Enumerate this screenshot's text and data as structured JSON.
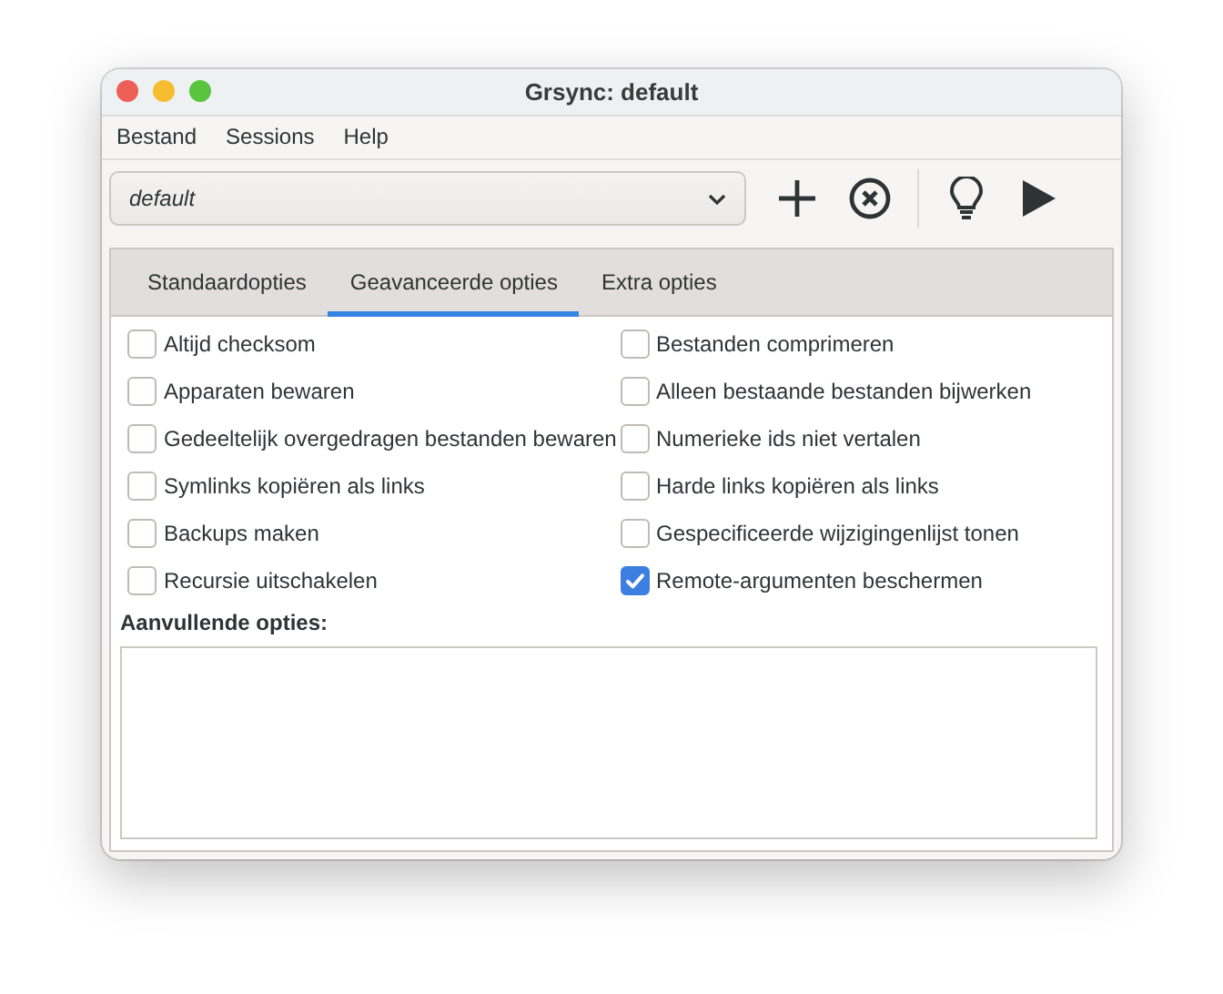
{
  "window": {
    "title": "Grsync: default"
  },
  "menu": [
    {
      "label": "Bestand"
    },
    {
      "label": "Sessions"
    },
    {
      "label": "Help"
    }
  ],
  "session": {
    "value": "default"
  },
  "tabs": [
    {
      "label": "Standaardopties",
      "selected": false
    },
    {
      "label": "Geavanceerde opties",
      "selected": true
    },
    {
      "label": "Extra opties",
      "selected": false
    }
  ],
  "option_columns": [
    {
      "options": [
        {
          "label": "Altijd checksom",
          "checked": false
        },
        {
          "label": "Apparaten bewaren",
          "checked": false
        },
        {
          "label": "Gedeeltelijk overgedragen bestanden bewaren",
          "checked": false
        },
        {
          "label": "Symlinks kopiëren als links",
          "checked": false
        },
        {
          "label": "Backups maken",
          "checked": false
        },
        {
          "label": "Recursie uitschakelen",
          "checked": false
        }
      ]
    },
    {
      "options": [
        {
          "label": "Bestanden comprimeren",
          "checked": false
        },
        {
          "label": "Alleen bestaande bestanden bijwerken",
          "checked": false
        },
        {
          "label": "Numerieke ids niet vertalen",
          "checked": false
        },
        {
          "label": "Harde links kopiëren als links",
          "checked": false
        },
        {
          "label": "Gespecificeerde wijzigingenlijst tonen",
          "checked": false
        },
        {
          "label": "Remote-argumenten beschermen",
          "checked": true
        }
      ]
    }
  ],
  "extra_options_label": "Aanvullende opties:"
}
